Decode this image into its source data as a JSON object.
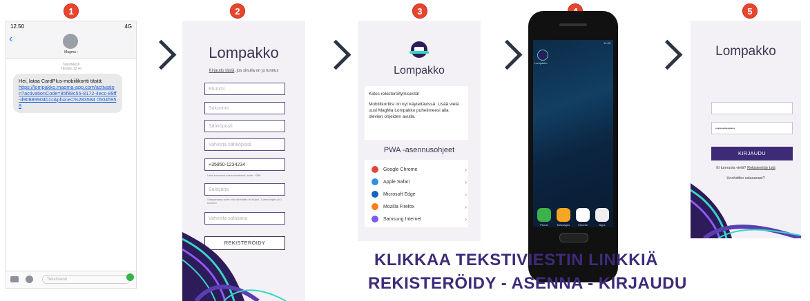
{
  "steps": [
    "1",
    "2",
    "3",
    "4",
    "5"
  ],
  "sms": {
    "time": "12.50",
    "signal": "4G",
    "contact": "Magma ›",
    "timestamp_line1": "Tekstiviesti",
    "timestamp_line2": "Tänään 12.47",
    "message": "Hei, lataa CardPlus-mobiilikortti tästä:",
    "link": "https://lompakko.magma-app.com/activation?activationCode=85f88c55-8172-4ecc-89ff-d90889904b1c&phone=%283584 05045958",
    "input_placeholder": "Tekstiviesti"
  },
  "register": {
    "title": "Lompakko",
    "login_link_text": "Kirjaudu tästä",
    "login_suffix": "jos sinulla on jo tunnus",
    "fields": [
      "Etunimi",
      "Sukunimi",
      "Sähköposti",
      "Vahvista sähköposti",
      "+35850-1234234",
      "Salasana",
      "Vahvista salasana"
    ],
    "phone_note": "Laita numerosi ensin maakoodi, esim. +358",
    "password_note": "Salasanassa tulee olla vähintään isi kirjain, 1 pieni kirjain ja 1 numero",
    "button": "REKISTERÖIDY"
  },
  "install": {
    "title": "Lompakko",
    "thanks": "Kiitos rekisteröitymisestä!",
    "body": "Mobiilikorttisi on nyt käytettävissä. Lisää vielä uusi MagMa Lompakko puhelimeesi alla olevien ohjeiden avulla.",
    "pwa_title": "PWA -asennusohjeet",
    "browsers": [
      {
        "name": "Google Chrome",
        "color": "#e0473a"
      },
      {
        "name": "Apple Safari",
        "color": "#2f8fe6"
      },
      {
        "name": "Microsoft Edge",
        "color": "#1565c0"
      },
      {
        "name": "Mozilla Firefox",
        "color": "#ff7b1c"
      },
      {
        "name": "Samsung Internet",
        "color": "#7a5cf0"
      }
    ]
  },
  "phone": {
    "status": "14:35",
    "app_label": "Lompakko",
    "dock": [
      "Phone",
      "Messages",
      "Chrome",
      "Apps"
    ]
  },
  "login": {
    "title": "Lompakko",
    "password_mask": "••••••••••••••••",
    "button": "KIRJAUDU",
    "no_account": "Ei tunnusta vielä?",
    "register_link": "Rekisteröidy tstä",
    "forgot": "Unohditko salasanasi?"
  },
  "headline": {
    "line1": "KLIKKAA TEKSTIVIESTIN LINKKIÄ",
    "line2": "REKISTERÖIDY - ASENNA - KIRJAUDU"
  },
  "colors": {
    "badge": "#e8452f",
    "brand": "#3d2b78",
    "arrow": "#2c3541"
  }
}
